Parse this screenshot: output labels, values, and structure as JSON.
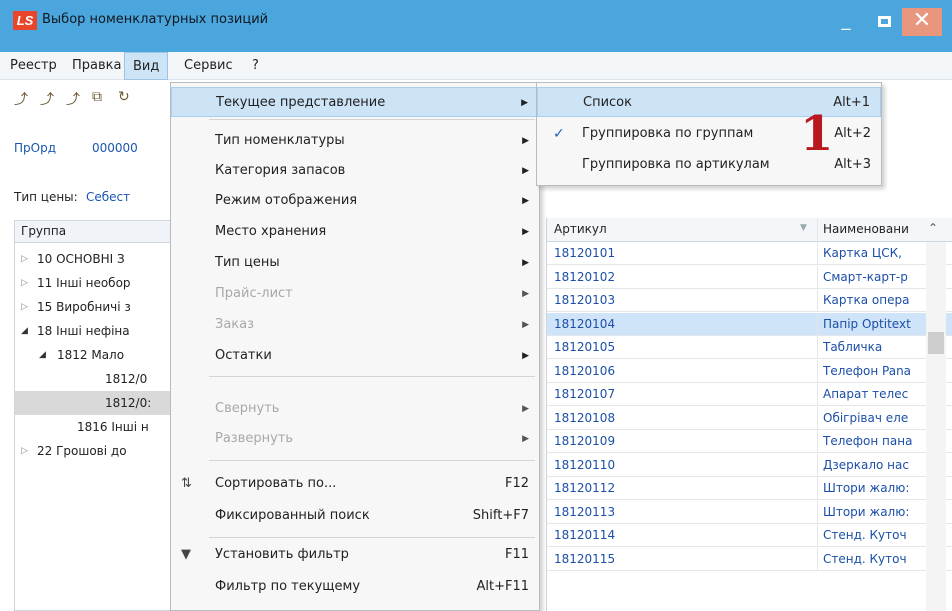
{
  "window": {
    "logo": "LS",
    "title": "Выбор номенклатурных позиций",
    "min": "_",
    "close": "✕"
  },
  "menubar": [
    "Реестр",
    "Правка",
    "Вид",
    "Сервис",
    "?"
  ],
  "form": {
    "org_label": "ПрОрд",
    "org_code": "000000",
    "price_label": "Тип цены:",
    "price_value": "Себест"
  },
  "groups": {
    "header": "Группа",
    "rows": [
      {
        "text": "10 ОСНОВНІ З"
      },
      {
        "text": "11 Інші необор"
      },
      {
        "text": "15 Виробничі з"
      },
      {
        "text": "18 Інші нефіна"
      },
      {
        "text": "1812 Мало"
      },
      {
        "text": "1812/0"
      },
      {
        "text": "1812/0:"
      },
      {
        "text": "1816 Інші н"
      },
      {
        "text": "22 Грошові до"
      }
    ]
  },
  "grid": {
    "col_article": "Артикул",
    "col_name": "Наименовани",
    "rows": [
      {
        "article": "18120101",
        "name": "Картка ЦСК,"
      },
      {
        "article": "18120102",
        "name": "Смарт-карт-р"
      },
      {
        "article": "18120103",
        "name": "Картка опера"
      },
      {
        "article": "18120104",
        "name": "Папір Optitext"
      },
      {
        "article": "18120105",
        "name": "Табличка"
      },
      {
        "article": "18120106",
        "name": "Телефон Pana"
      },
      {
        "article": "18120107",
        "name": "Апарат телес"
      },
      {
        "article": "18120108",
        "name": "Обігрівач еле"
      },
      {
        "article": "18120109",
        "name": "Телефон пана"
      },
      {
        "article": "18120110",
        "name": "Дзеркало нас"
      },
      {
        "article": "18120112",
        "name": "Штори жалю:"
      },
      {
        "article": "18120113",
        "name": "Штори жалю:"
      },
      {
        "article": "18120114",
        "name": "Стенд. Куточ"
      },
      {
        "article": "18120115",
        "name": "Стенд. Куточ"
      }
    ]
  },
  "view_menu": {
    "items": [
      {
        "label": "Текущее представление",
        "shortcut": ""
      },
      {
        "label": "Тип номенклатуры",
        "shortcut": ""
      },
      {
        "label": "Категория запасов",
        "shortcut": ""
      },
      {
        "label": "Режим отображения",
        "shortcut": ""
      },
      {
        "label": "Место хранения",
        "shortcut": ""
      },
      {
        "label": "Тип цены",
        "shortcut": ""
      },
      {
        "label": "Прайс-лист",
        "shortcut": ""
      },
      {
        "label": "Заказ",
        "shortcut": ""
      },
      {
        "label": "Остатки",
        "shortcut": ""
      },
      {
        "label": "Свернуть",
        "shortcut": ""
      },
      {
        "label": "Развернуть",
        "shortcut": ""
      },
      {
        "label": "Сортировать по...",
        "shortcut": "F12"
      },
      {
        "label": "Фиксированный поиск",
        "shortcut": "Shift+F7"
      },
      {
        "label": "Установить фильтр",
        "shortcut": "F11"
      },
      {
        "label": "Фильтр по текущему",
        "shortcut": "Alt+F11"
      }
    ]
  },
  "sub_menu": {
    "items": [
      {
        "label": "Список",
        "shortcut": "Alt+1"
      },
      {
        "label": "Группировка по группам",
        "shortcut": "Alt+2"
      },
      {
        "label": "Группировка по артикулам",
        "shortcut": "Alt+3"
      }
    ],
    "check": "✓"
  },
  "annotation": "1",
  "colors": {
    "titlebar": "#4aa6dc",
    "highlight": "#cde3f6",
    "link_text": "#1c4fa8",
    "annotation": "#b8181e"
  }
}
